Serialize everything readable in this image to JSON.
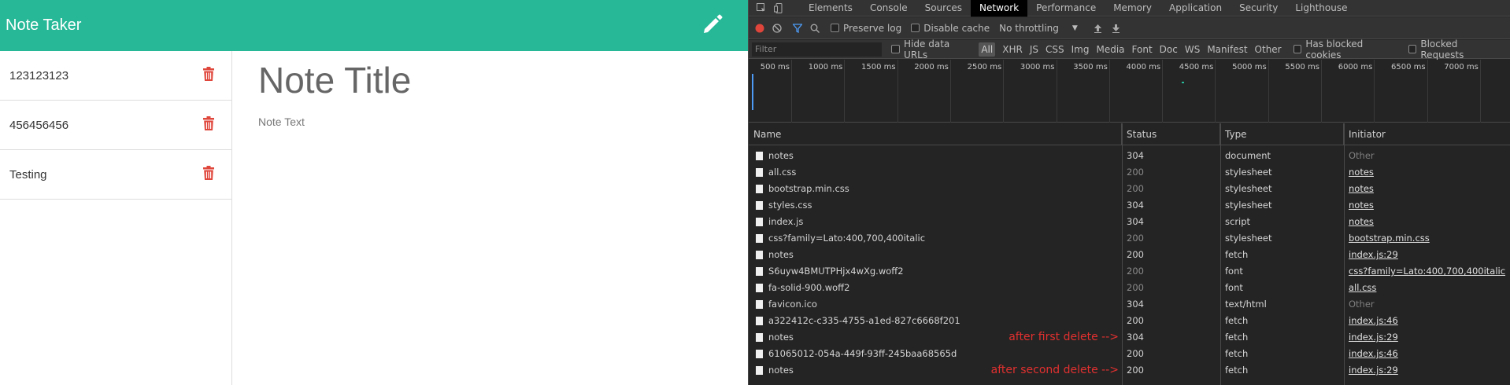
{
  "app": {
    "brand": "Note Taker",
    "notes": [
      {
        "title": "123123123"
      },
      {
        "title": "456456456"
      },
      {
        "title": "Testing"
      }
    ],
    "editor": {
      "title_placeholder": "Note Title",
      "text_placeholder": "Note Text"
    },
    "colors": {
      "navbar": "#26b897",
      "trash": "#e0473c"
    }
  },
  "devtools": {
    "tabs": [
      "Elements",
      "Console",
      "Sources",
      "Network",
      "Performance",
      "Memory",
      "Application",
      "Security",
      "Lighthouse"
    ],
    "active_tab": "Network",
    "toolbar": {
      "preserve_log": "Preserve log",
      "disable_cache": "Disable cache",
      "throttling": "No throttling"
    },
    "filter": {
      "placeholder": "Filter",
      "hide_data_urls": "Hide data URLs",
      "types": [
        "All",
        "XHR",
        "JS",
        "CSS",
        "Img",
        "Media",
        "Font",
        "Doc",
        "WS",
        "Manifest",
        "Other"
      ],
      "has_blocked_cookies": "Has blocked cookies",
      "blocked_requests": "Blocked Requests"
    },
    "timeline_ticks": [
      "500 ms",
      "1000 ms",
      "1500 ms",
      "2000 ms",
      "2500 ms",
      "3000 ms",
      "3500 ms",
      "4000 ms",
      "4500 ms",
      "5000 ms",
      "5500 ms",
      "6000 ms",
      "6500 ms",
      "7000 ms"
    ],
    "columns": {
      "name": "Name",
      "status": "Status",
      "type": "Type",
      "initiator": "Initiator"
    },
    "rows": [
      {
        "name": "notes",
        "status": "304",
        "type": "document",
        "initiator": "Other",
        "note": ""
      },
      {
        "name": "all.css",
        "status": "200",
        "type": "stylesheet",
        "initiator": "notes",
        "note": ""
      },
      {
        "name": "bootstrap.min.css",
        "status": "200",
        "type": "stylesheet",
        "initiator": "notes",
        "note": ""
      },
      {
        "name": "styles.css",
        "status": "304",
        "type": "stylesheet",
        "initiator": "notes",
        "note": ""
      },
      {
        "name": "index.js",
        "status": "304",
        "type": "script",
        "initiator": "notes",
        "note": ""
      },
      {
        "name": "css?family=Lato:400,700,400italic",
        "status": "200",
        "type": "stylesheet",
        "initiator": "bootstrap.min.css",
        "note": ""
      },
      {
        "name": "notes",
        "status": "200",
        "type": "fetch",
        "initiator": "index.js:29",
        "note": ""
      },
      {
        "name": "S6uyw4BMUTPHjx4wXg.woff2",
        "status": "200",
        "type": "font",
        "initiator": "css?family=Lato:400,700,400italic",
        "note": ""
      },
      {
        "name": "fa-solid-900.woff2",
        "status": "200",
        "type": "font",
        "initiator": "all.css",
        "note": ""
      },
      {
        "name": "favicon.ico",
        "status": "304",
        "type": "text/html",
        "initiator": "Other",
        "note": ""
      },
      {
        "name": "a322412c-c335-4755-a1ed-827c6668f201",
        "status": "200",
        "type": "fetch",
        "initiator": "index.js:46",
        "note": ""
      },
      {
        "name": "notes",
        "status": "304",
        "type": "fetch",
        "initiator": "index.js:29",
        "note": "after first delete -->"
      },
      {
        "name": "61065012-054a-449f-93ff-245baa68565d",
        "status": "200",
        "type": "fetch",
        "initiator": "index.js:46",
        "note": ""
      },
      {
        "name": "notes",
        "status": "200",
        "type": "fetch",
        "initiator": "index.js:29",
        "note": "after second delete -->"
      }
    ]
  }
}
